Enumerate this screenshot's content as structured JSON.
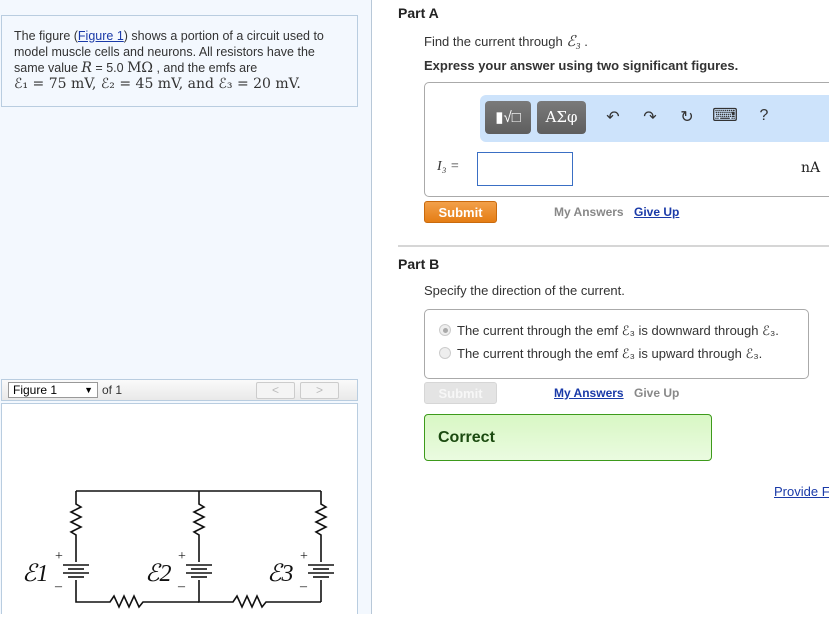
{
  "problem": {
    "text_before_link": "The figure (",
    "figure_link": "Figure 1",
    "text_after_link": ") shows a portion of a circuit used to model muscle cells and neurons. All resistors have the same value ",
    "R_symbol": "R",
    "R_value": " = 5.0 ",
    "R_unit": "MΩ",
    "emf_intro": " , and the emfs are",
    "emf_line": "ℰ₁ = 75 mV, ℰ₂ = 45 mV, and ℰ₃ = 20 mV."
  },
  "figure_nav": {
    "selected": "Figure 1",
    "of_label": "of 1",
    "prev_label": "<",
    "next_label": ">"
  },
  "figure": {
    "labels": [
      "ℰ1",
      "ℰ2",
      "ℰ3"
    ],
    "plus": "+",
    "minus": "–"
  },
  "partA": {
    "title": "Part A",
    "question_prefix": "Find the current through ",
    "question_symbol": "ℰ₃",
    "question_suffix": " .",
    "instruction": "Express your answer using two significant figures.",
    "toolbar": {
      "templates_label": "▮√□",
      "symbols_label": "ΑΣφ",
      "undo": "↶",
      "redo": "↷",
      "reset": "↻",
      "keyboard": "⌨",
      "help": "?"
    },
    "input_label": "I₃ =",
    "input_value": "",
    "unit": "nA",
    "submit_label": "Submit",
    "my_answers_label": "My Answers",
    "give_up_label": "Give Up"
  },
  "partB": {
    "title": "Part B",
    "question": "Specify the direction of the current.",
    "options": [
      {
        "label": "The current through the emf ℰ₃ is downward through ℰ₃.",
        "selected": true
      },
      {
        "label": "The current through the emf ℰ₃ is upward through ℰ₃.",
        "selected": false
      }
    ],
    "submit_label": "Submit",
    "my_answers_label": "My Answers",
    "give_up_label": "Give Up",
    "result": "Correct"
  },
  "feedback_link": "Provide Feedback"
}
